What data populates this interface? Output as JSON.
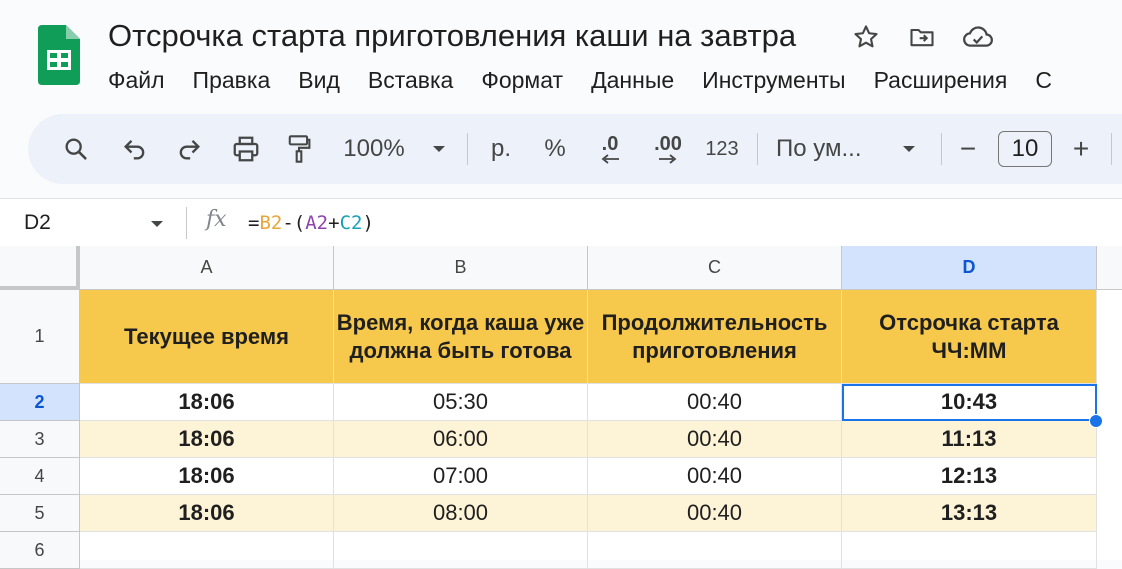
{
  "app": {
    "title": "Отсрочка старта приготовления каши на завтра",
    "accent_color": "#1a73e8",
    "header_fill_color": "#f6c84c",
    "band_fill_color": "#fdf3d7"
  },
  "menu": [
    "Файл",
    "Правка",
    "Вид",
    "Вставка",
    "Формат",
    "Данные",
    "Инструменты",
    "Расширения",
    "С"
  ],
  "toolbar": {
    "zoom": "100%",
    "currency": "р.",
    "percent": "%",
    "decrease_decimals": ".0",
    "increase_decimals": ".00",
    "more_formats": "123",
    "font": "По ум...",
    "decrease_font": "−",
    "font_size": "10",
    "increase_font": "+"
  },
  "formula_bar": {
    "cell_ref": "D2",
    "fx": "fx",
    "formula_parts": [
      "=",
      "B2",
      "-(",
      "A2",
      "+",
      "C2",
      ")"
    ]
  },
  "grid": {
    "columns": [
      "A",
      "B",
      "C",
      "D"
    ],
    "rows": [
      "1",
      "2",
      "3",
      "4",
      "5",
      "6"
    ],
    "headers": [
      "Текущее время",
      "Время, когда каша уже должна быть готова",
      "Продолжительность приготовления",
      "Отсрочка старта ЧЧ:ММ"
    ],
    "data": [
      [
        "18:06",
        "05:30",
        "00:40",
        "10:43"
      ],
      [
        "18:06",
        "06:00",
        "00:40",
        "11:13"
      ],
      [
        "18:06",
        "07:00",
        "00:40",
        "12:13"
      ],
      [
        "18:06",
        "08:00",
        "00:40",
        "13:13"
      ]
    ]
  }
}
